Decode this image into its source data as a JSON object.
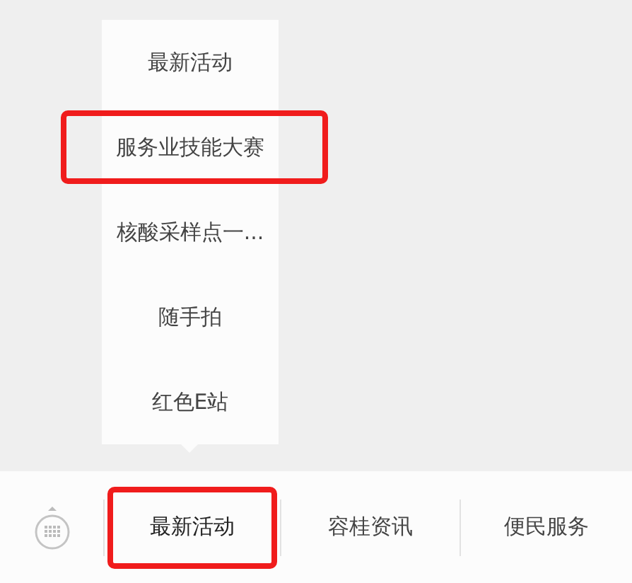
{
  "submenu": {
    "items": [
      {
        "label": "最新活动",
        "highlighted": false
      },
      {
        "label": "服务业技能大赛",
        "highlighted": true
      },
      {
        "label": "核酸采样点一...",
        "highlighted": false
      },
      {
        "label": "随手拍",
        "highlighted": false
      },
      {
        "label": "红色E站",
        "highlighted": false
      }
    ]
  },
  "menu_bar": {
    "tabs": [
      {
        "label": "最新活动",
        "selected": true,
        "highlighted": true
      },
      {
        "label": "容桂资讯",
        "selected": false,
        "highlighted": false
      },
      {
        "label": "便民服务",
        "selected": false,
        "highlighted": false
      }
    ]
  }
}
